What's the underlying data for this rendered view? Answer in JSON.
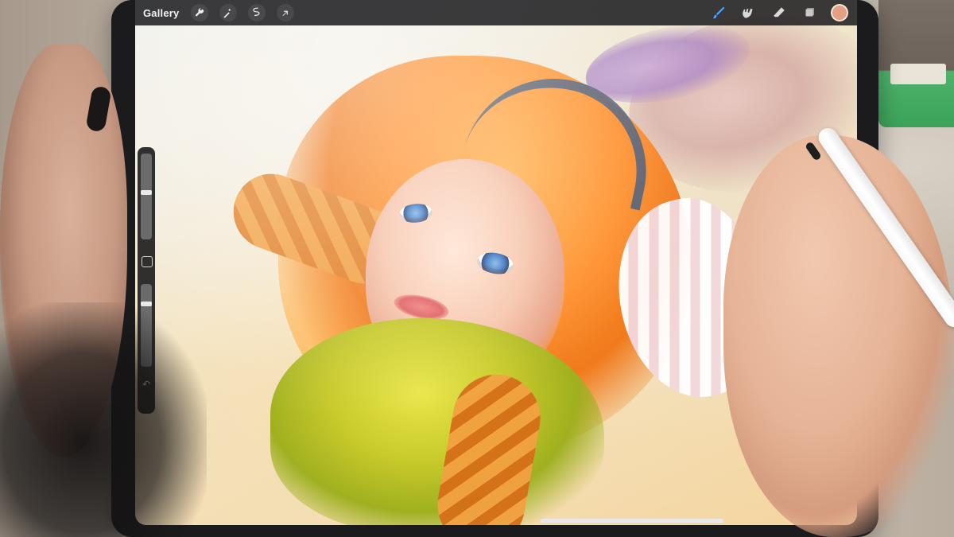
{
  "app": {
    "topbar": {
      "gallery_label": "Gallery",
      "left_tools": [
        {
          "name": "wrench-icon"
        },
        {
          "name": "magic-wand-icon"
        },
        {
          "name": "selection-icon"
        },
        {
          "name": "transform-arrow-icon"
        }
      ],
      "right_tools": [
        {
          "name": "brush-icon",
          "active": true
        },
        {
          "name": "smudge-icon",
          "active": false
        },
        {
          "name": "eraser-icon",
          "active": false
        },
        {
          "name": "layers-icon",
          "active": false
        }
      ],
      "color": "#e2a184"
    },
    "sidebar": {
      "brush_size_level": 0.55,
      "opacity_level": 0.78,
      "modify_button_icon": "square-icon",
      "undo_icon": "undo-icon"
    }
  },
  "colors": {
    "toolbar_bg": "#19191c",
    "accent_active": "#4ea4ff"
  }
}
